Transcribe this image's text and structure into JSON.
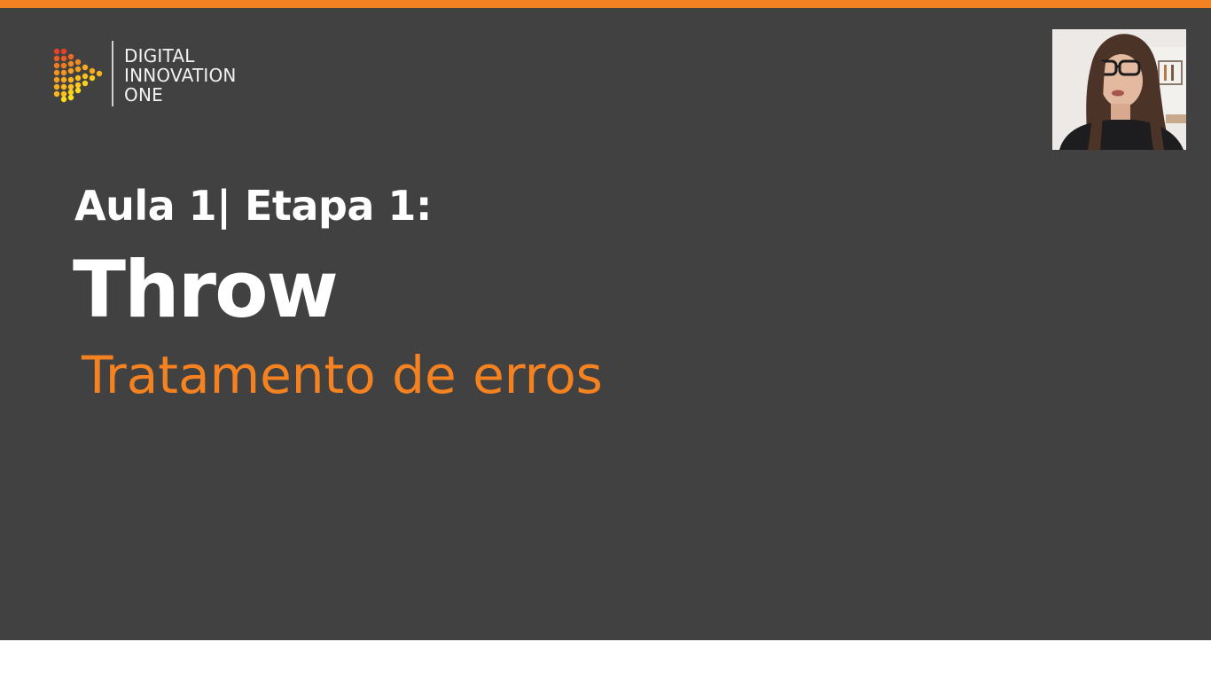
{
  "brand": {
    "logo_lines": [
      "DIGITAL",
      "INNOVATION",
      "ONE"
    ],
    "accent_color": "#f58220",
    "slide_background": "#414141"
  },
  "slide": {
    "lesson_label": "Aula 1| Etapa 1:",
    "title": "Throw",
    "subtitle": "Tratamento de erros"
  },
  "webcam": {
    "icon": "presenter-video-icon"
  }
}
